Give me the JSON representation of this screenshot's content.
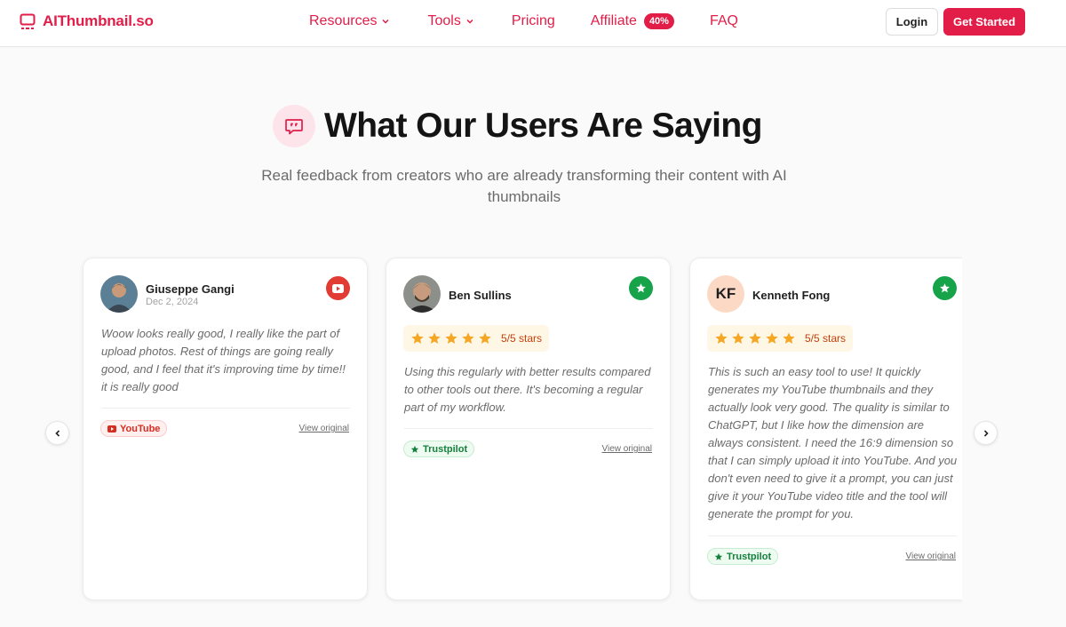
{
  "nav": {
    "logo": "AIThumbnail.so",
    "links": [
      {
        "label": "Resources",
        "has_dropdown": true
      },
      {
        "label": "Tools",
        "has_dropdown": true
      },
      {
        "label": "Pricing"
      },
      {
        "label": "Affiliate",
        "badge": "40%"
      },
      {
        "label": "FAQ"
      }
    ],
    "login": "Login",
    "get_started": "Get Started"
  },
  "section": {
    "icon": "chat-quote-icon",
    "title": "What Our Users Are Saying",
    "subtitle": "Real feedback from creators who are already transforming their content with AI thumbnails"
  },
  "testimonials": [
    {
      "name": "Giuseppe Gangi",
      "date": "Dec 2, 2024",
      "source": "YouTube",
      "source_icon": "youtube-icon",
      "quote": "Woow looks really good, I really like the part of upload photos. Rest of things are going really good, and I feel that it's improving time by time!! it is really good",
      "view_original": "View original"
    },
    {
      "name": "Ben Sullins",
      "rating": 5,
      "rating_text": "5/5 stars",
      "source": "Trustpilot",
      "source_icon": "trustpilot-star-icon",
      "quote": "Using this regularly with better results compared to other tools out there. It's becoming a regular part of my workflow.",
      "view_original": "View original"
    },
    {
      "name": "Kenneth Fong",
      "initials": "KF",
      "rating": 5,
      "rating_text": "5/5 stars",
      "source": "Trustpilot",
      "source_icon": "trustpilot-star-icon",
      "quote": "This is such an easy tool to use! It quickly generates my YouTube thumbnails and they actually look very good. The quality is similar to ChatGPT, but I like how the dimension are always consistent. I need the 16:9 dimension so that I can simply upload it into YouTube. And you don't even need to give it a prompt, you can just give it your YouTube video title and the tool will generate the prompt for you.",
      "view_original": "View original"
    }
  ],
  "colors": {
    "brand": "#e11d48",
    "youtube": "#e23b34",
    "trustpilot": "#16a34a",
    "star": "#f5a623"
  }
}
